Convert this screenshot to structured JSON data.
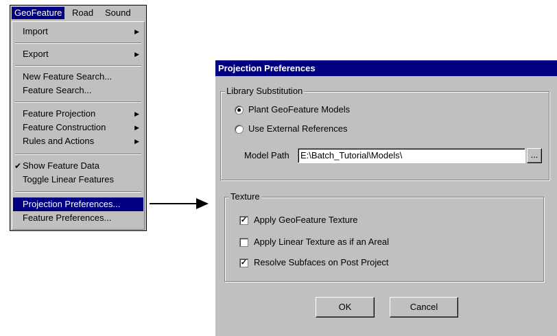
{
  "menubar": {
    "items": [
      "GeoFeature",
      "Road",
      "Sound"
    ]
  },
  "menu": {
    "items": [
      {
        "label": "Import",
        "submenu": true
      },
      {
        "label": "Export",
        "submenu": true
      },
      {
        "label": "New Feature Search..."
      },
      {
        "label": "Feature Search..."
      },
      {
        "label": "Feature Projection",
        "submenu": true
      },
      {
        "label": "Feature Construction",
        "submenu": true
      },
      {
        "label": "Rules and Actions",
        "submenu": true
      },
      {
        "label": "Show Feature Data",
        "checked": true
      },
      {
        "label": "Toggle Linear Features"
      },
      {
        "label": "Projection Preferences...",
        "selected": true
      },
      {
        "label": "Feature Preferences..."
      }
    ],
    "check_glyph": "✔",
    "arrow_glyph": "▶"
  },
  "dialog": {
    "title": "Projection Preferences",
    "library": {
      "legend": "Library Substitution",
      "option1": "Plant GeoFeature Models",
      "option2": "Use External References",
      "selected": 1,
      "model_path_label": "Model Path",
      "model_path_value": "E:\\Batch_Tutorial\\Models\\",
      "browse_label": "..."
    },
    "texture": {
      "legend": "Texture",
      "options": [
        {
          "label": "Apply GeoFeature Texture",
          "checked": true
        },
        {
          "label": "Apply Linear Texture as if an Areal",
          "checked": false
        },
        {
          "label": "Resolve Subfaces on Post Project",
          "checked": true
        }
      ],
      "check_glyph": "✓"
    },
    "ok_label": "OK",
    "cancel_label": "Cancel"
  }
}
